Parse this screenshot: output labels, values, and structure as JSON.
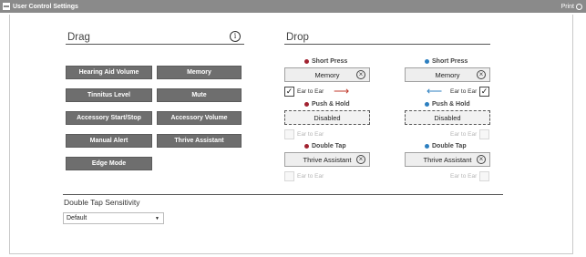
{
  "header": {
    "title": "User Control Settings",
    "print_label": "Print"
  },
  "drag": {
    "heading": "Drag",
    "info_icon_text": "i",
    "buttons": [
      "Hearing Aid Volume",
      "Memory",
      "Tinnitus Level",
      "Mute",
      "Accessory Start/Stop",
      "Accessory Volume",
      "Manual Alert",
      "Thrive Assistant",
      "Edge Mode"
    ]
  },
  "drop": {
    "heading": "Drop",
    "left": {
      "short_press": {
        "label": "Short Press",
        "value": "Memory",
        "ear_to_ear": "Ear to Ear",
        "checked": true
      },
      "push_hold": {
        "label": "Push & Hold",
        "value": "Disabled",
        "ear_to_ear": "Ear to Ear",
        "checked": false
      },
      "double_tap": {
        "label": "Double Tap",
        "value": "Thrive Assistant",
        "ear_to_ear": "Ear to Ear",
        "checked": false
      }
    },
    "right": {
      "short_press": {
        "label": "Short Press",
        "value": "Memory",
        "ear_to_ear": "Ear to Ear",
        "checked": true
      },
      "push_hold": {
        "label": "Push & Hold",
        "value": "Disabled",
        "ear_to_ear": "Ear to Ear",
        "checked": false
      },
      "double_tap": {
        "label": "Double Tap",
        "value": "Thrive Assistant",
        "ear_to_ear": "Ear to Ear",
        "checked": false
      }
    },
    "clear_glyph": "×",
    "check_glyph": "✓",
    "arrow_right": "⟶",
    "arrow_left": "⟵"
  },
  "sensitivity": {
    "label": "Double Tap Sensitivity",
    "selected": "Default"
  },
  "colors": {
    "left_side": "#a12230",
    "right_side": "#2c7fc0",
    "header_bar": "#8a8a8a",
    "drag_button": "#6e6e6e"
  }
}
